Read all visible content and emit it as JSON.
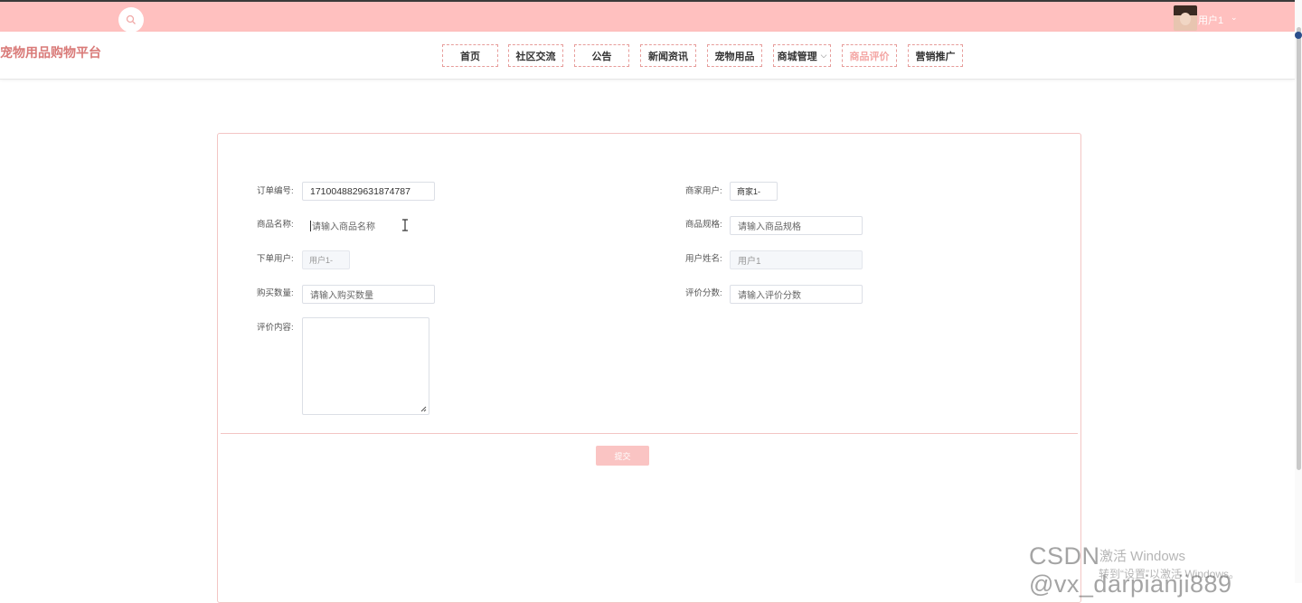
{
  "topbar": {
    "user_name": "用户1",
    "user_caret": "⌄"
  },
  "header": {
    "brand": "宠物用品购物平台",
    "nav": [
      {
        "label": "首页"
      },
      {
        "label": "社区交流"
      },
      {
        "label": "公告"
      },
      {
        "label": "新闻资讯"
      },
      {
        "label": "宠物用品"
      },
      {
        "label": "商城管理",
        "chevron": "⌵"
      },
      {
        "label": "商品评价",
        "active": true
      },
      {
        "label": "营销推广"
      }
    ]
  },
  "form": {
    "order_no": {
      "label": "订单编号:",
      "value": "1710048829631874787"
    },
    "merchant_user": {
      "label": "商家用户:",
      "value": "商家1-"
    },
    "product_name": {
      "label": "商品名称:",
      "placeholder": "请输入商品名称"
    },
    "product_spec": {
      "label": "商品规格:",
      "placeholder": "请输入商品规格"
    },
    "order_user": {
      "label": "下单用户:",
      "value": "用户1-"
    },
    "user_realname": {
      "label": "用户姓名:",
      "value": "用户1"
    },
    "quantity": {
      "label": "购买数量:",
      "placeholder": "请输入购买数量"
    },
    "score": {
      "label": "评价分数:",
      "placeholder": "请输入评价分数"
    },
    "content": {
      "label": "评价内容:"
    },
    "submit_label": "提交"
  },
  "overlay": {
    "csdn": "CSDN @vx_darpianji889",
    "activate_line1": "激活 Windows",
    "activate_line2": "转到“设置”以激活 Windows。"
  },
  "colors": {
    "topbar": "#ffc0bf",
    "brand": "#d97a78",
    "nav_border": "#e79c9a",
    "panel_border": "#f3c5c4",
    "submit": "#fac4c3"
  }
}
